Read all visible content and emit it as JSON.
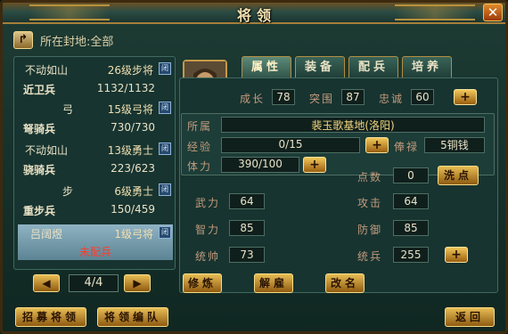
{
  "window": {
    "title": "将领",
    "close_label": "✕"
  },
  "location": {
    "back_icon": "↱",
    "text": "所在封地:全部"
  },
  "roster": [
    {
      "type": "general",
      "name": "不动如山",
      "rank": "26级步将",
      "badge": "闭"
    },
    {
      "type": "platoon",
      "name": "近卫兵",
      "count": "1132/1132"
    },
    {
      "type": "general",
      "name": "弓",
      "rank": "15级弓将",
      "badge": "闭"
    },
    {
      "type": "platoon",
      "name": "弩骑兵",
      "count": "730/730"
    },
    {
      "type": "general",
      "name": "不动如山",
      "rank": "13级勇士",
      "badge": "闭"
    },
    {
      "type": "platoon",
      "name": "骁骑兵",
      "count": "223/623"
    },
    {
      "type": "general",
      "name": "步",
      "rank": "6级勇士",
      "badge": "闭"
    },
    {
      "type": "platoon",
      "name": "重步兵",
      "count": "150/459"
    },
    {
      "type": "general",
      "name": "吕阔煜",
      "rank": "1级弓将",
      "badge": "闭",
      "selected": true
    },
    {
      "type": "status",
      "text": "未配兵"
    }
  ],
  "pager": {
    "prev_icon": "◀",
    "next_icon": "▶",
    "page": "4/4"
  },
  "tabs": [
    {
      "label": "属性",
      "active": true
    },
    {
      "label": "装备",
      "active": false
    },
    {
      "label": "配兵",
      "active": false
    },
    {
      "label": "培养",
      "active": false
    }
  ],
  "top_stats": {
    "growth_label": "成长",
    "growth": "78",
    "breakout_label": "突围",
    "breakout": "87",
    "loyalty_label": "忠诚",
    "loyalty": "60"
  },
  "info": {
    "belong_label": "所属",
    "belong": "裴玉歌基地(洛阳)",
    "exp_label": "经验",
    "exp": "0/15",
    "salary_label": "俸禄",
    "salary": "5铜钱",
    "stamina_label": "体力",
    "stamina": "390/100"
  },
  "points": {
    "label": "点数",
    "value": "0",
    "wash_label": "洗点"
  },
  "attributes": {
    "force_label": "武力",
    "force": "64",
    "attack_label": "攻击",
    "attack": "64",
    "intel_label": "智力",
    "intel": "85",
    "defense_label": "防御",
    "defense": "85",
    "command_label": "统帅",
    "command": "73",
    "troops_label": "统兵",
    "troops": "255"
  },
  "actions": {
    "train": "修炼",
    "dismiss": "解雇",
    "rename": "改名"
  },
  "bottom": {
    "recruit": "招募将领",
    "formation": "将领编队",
    "back": "返回"
  },
  "plus_label": "+"
}
